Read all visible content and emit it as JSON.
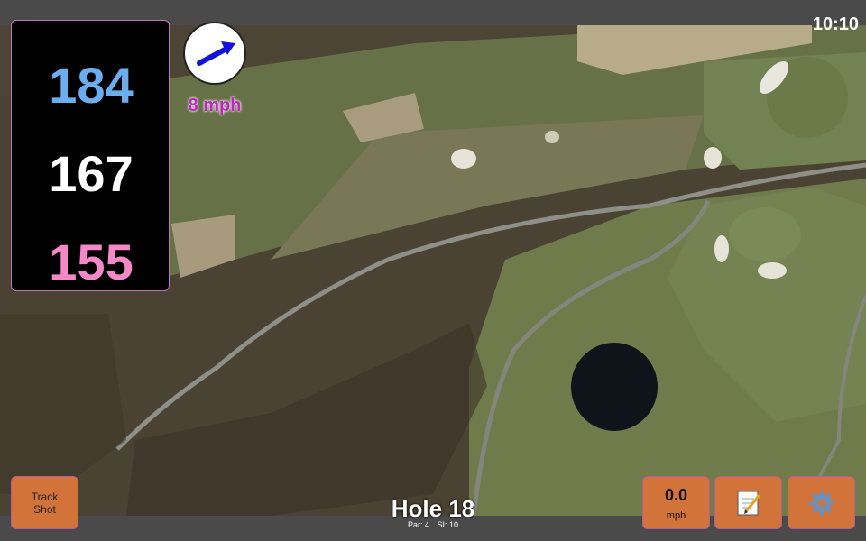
{
  "status_bar": {
    "time": "10:10"
  },
  "distances": {
    "back": "184",
    "middle": "167",
    "front": "155"
  },
  "wind": {
    "speed_label": "8 mph",
    "direction_icon": "arrow-up-right-icon"
  },
  "buttons": {
    "track_shot": "Track\nShot",
    "wind_value": "0.0",
    "wind_unit": "mph",
    "notes_icon": "notepad-icon",
    "settings_icon": "gear-icon"
  },
  "hole": {
    "title": "Hole 18",
    "par": "Par: 4",
    "si": "SI: 10"
  },
  "colors": {
    "back": "#6aaef0",
    "middle": "#ffffff",
    "front": "#f589c8",
    "button": "#d2733a",
    "wind_text": "#c026c0"
  }
}
